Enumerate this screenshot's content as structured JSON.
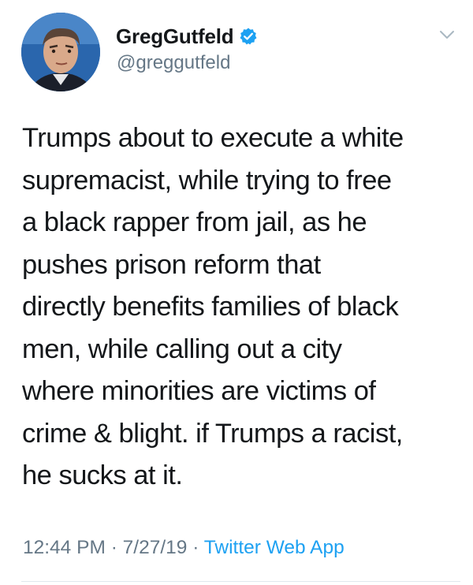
{
  "user": {
    "display_name": "GregGutfeld",
    "handle": "@greggutfeld",
    "verified": true
  },
  "tweet": {
    "lines": [
      "Trumps about to execute a white",
      "supremacist, while trying to free",
      "a black rapper from jail, as he",
      "pushes prison reform that",
      "directly benefits families of black",
      "men, while calling out a city",
      "where minorities are victims of",
      "crime & blight. if Trumps a racist,",
      "he sucks at it."
    ],
    "time": "12:44 PM",
    "date": "7/27/19",
    "separator": "·",
    "source": "Twitter Web App"
  },
  "colors": {
    "text": "#14171a",
    "secondary": "#657786",
    "accent": "#1da1f2",
    "verified": "#1da1f2"
  },
  "icons": {
    "verified": "verified-badge-icon",
    "more": "chevron-down-icon"
  }
}
